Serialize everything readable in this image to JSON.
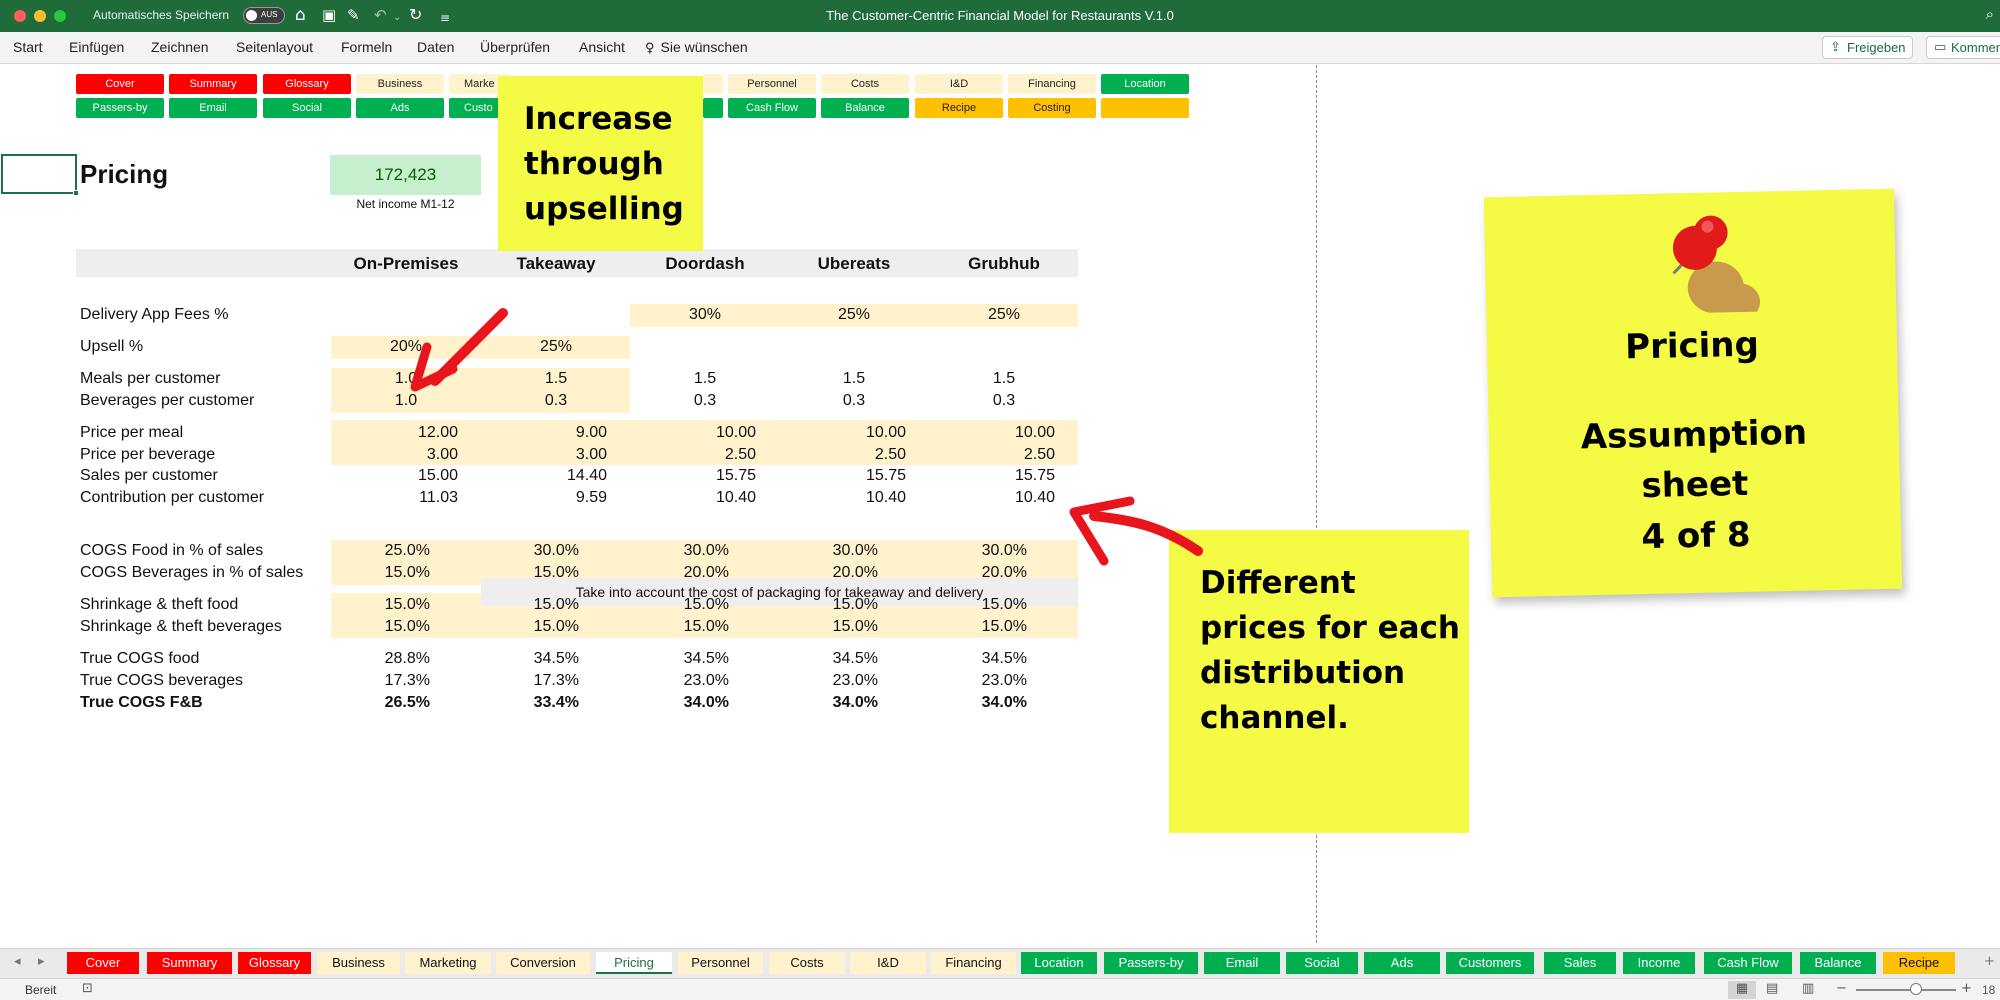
{
  "titlebar": {
    "autosave_label": "Automatisches Speichern",
    "autosave_state": "AUS",
    "window_title": "The Customer-Centric Financial Model for Restaurants V.1.0"
  },
  "menu": {
    "items": [
      "Start",
      "Einfügen",
      "Zeichnen",
      "Seitenlayout",
      "Formeln",
      "Daten",
      "Überprüfen",
      "Ansicht"
    ],
    "tell_me": "Sie wünschen",
    "share": "Freigeben",
    "comments": "Kommen"
  },
  "nav": {
    "row1": [
      "Cover",
      "Summary",
      "Glossary",
      "Business",
      "Marke",
      "",
      "",
      "Personnel",
      "Costs",
      "I&D",
      "Financing",
      "Location"
    ],
    "row2": [
      "Passers-by",
      "Email",
      "Social",
      "Ads",
      "Custo",
      "",
      "Cash Flow",
      "Balance",
      "Recipe",
      "Costing",
      ""
    ]
  },
  "page": {
    "title": "Pricing",
    "net_income_value": "172,423",
    "net_income_label": "Net income M1-12"
  },
  "table": {
    "columns": [
      "On-Premises",
      "Takeaway",
      "Doordash",
      "Ubereats",
      "Grubhub"
    ],
    "delivery_fees": {
      "label": "Delivery App Fees %",
      "values": [
        "30%",
        "25%",
        "25%"
      ]
    },
    "upsell": {
      "label": "Upsell %",
      "values": [
        "20%",
        "25%"
      ]
    },
    "meals_per_customer": {
      "label": "Meals per customer",
      "values": [
        "1.0",
        "1.5",
        "1.5",
        "1.5",
        "1.5"
      ]
    },
    "beverages_per_customer": {
      "label": "Beverages per customer",
      "values": [
        "1.0",
        "0.3",
        "0.3",
        "0.3",
        "0.3"
      ]
    },
    "price_per_meal": {
      "label": "Price per meal",
      "values": [
        "12.00",
        "9.00",
        "10.00",
        "10.00",
        "10.00"
      ]
    },
    "price_per_beverage": {
      "label": "Price per beverage",
      "values": [
        "3.00",
        "3.00",
        "2.50",
        "2.50",
        "2.50"
      ]
    },
    "sales_per_customer": {
      "label": "Sales per customer",
      "values": [
        "15.00",
        "14.40",
        "15.75",
        "15.75",
        "15.75"
      ]
    },
    "contribution_per_customer": {
      "label": "Contribution per customer",
      "values": [
        "11.03",
        "9.59",
        "10.40",
        "10.40",
        "10.40"
      ]
    },
    "packaging_note": "Take into account the cost of packaging for takeaway and delivery",
    "cogs_food": {
      "label": "COGS Food in % of sales",
      "values": [
        "25.0%",
        "30.0%",
        "30.0%",
        "30.0%",
        "30.0%"
      ]
    },
    "cogs_beverages": {
      "label": "COGS Beverages in % of sales",
      "values": [
        "15.0%",
        "15.0%",
        "20.0%",
        "20.0%",
        "20.0%"
      ]
    },
    "shrinkage_food": {
      "label": "Shrinkage & theft food",
      "values": [
        "15.0%",
        "15.0%",
        "15.0%",
        "15.0%",
        "15.0%"
      ]
    },
    "shrinkage_beverages": {
      "label": "Shrinkage & theft beverages",
      "values": [
        "15.0%",
        "15.0%",
        "15.0%",
        "15.0%",
        "15.0%"
      ]
    },
    "true_cogs_food": {
      "label": "True COGS food",
      "values": [
        "28.8%",
        "34.5%",
        "34.5%",
        "34.5%",
        "34.5%"
      ]
    },
    "true_cogs_beverages": {
      "label": "True COGS beverages",
      "values": [
        "17.3%",
        "17.3%",
        "23.0%",
        "23.0%",
        "23.0%"
      ]
    },
    "true_cogs_fb": {
      "label": "True COGS F&B",
      "values": [
        "26.5%",
        "33.4%",
        "34.0%",
        "34.0%",
        "34.0%"
      ]
    }
  },
  "notes": {
    "upsell_note": [
      "Increase",
      "through",
      "upselling"
    ],
    "prices_note": [
      "Different",
      "prices for each",
      "distribution",
      "channel."
    ],
    "big_note": {
      "title": "Pricing",
      "line1": "Assumption",
      "line2": "sheet",
      "line3": "4 of 8"
    }
  },
  "sheet_tabs": [
    "Cover",
    "Summary",
    "Glossary",
    "Business",
    "Marketing",
    "Conversion",
    "Pricing",
    "Personnel",
    "Costs",
    "I&D",
    "Financing",
    "Location",
    "Passers-by",
    "Email",
    "Social",
    "Ads",
    "Customers",
    "Sales",
    "Income",
    "Cash Flow",
    "Balance",
    "Recipe"
  ],
  "status": {
    "ready": "Bereit",
    "zoom": "18"
  },
  "colors": {
    "accent": "#1f6b3a",
    "red": "#ff0000",
    "green": "#00b050",
    "cream": "#fff2cc",
    "orange": "#ffc000",
    "sticky": "#f5fa45",
    "arrow": "#e8161c"
  }
}
